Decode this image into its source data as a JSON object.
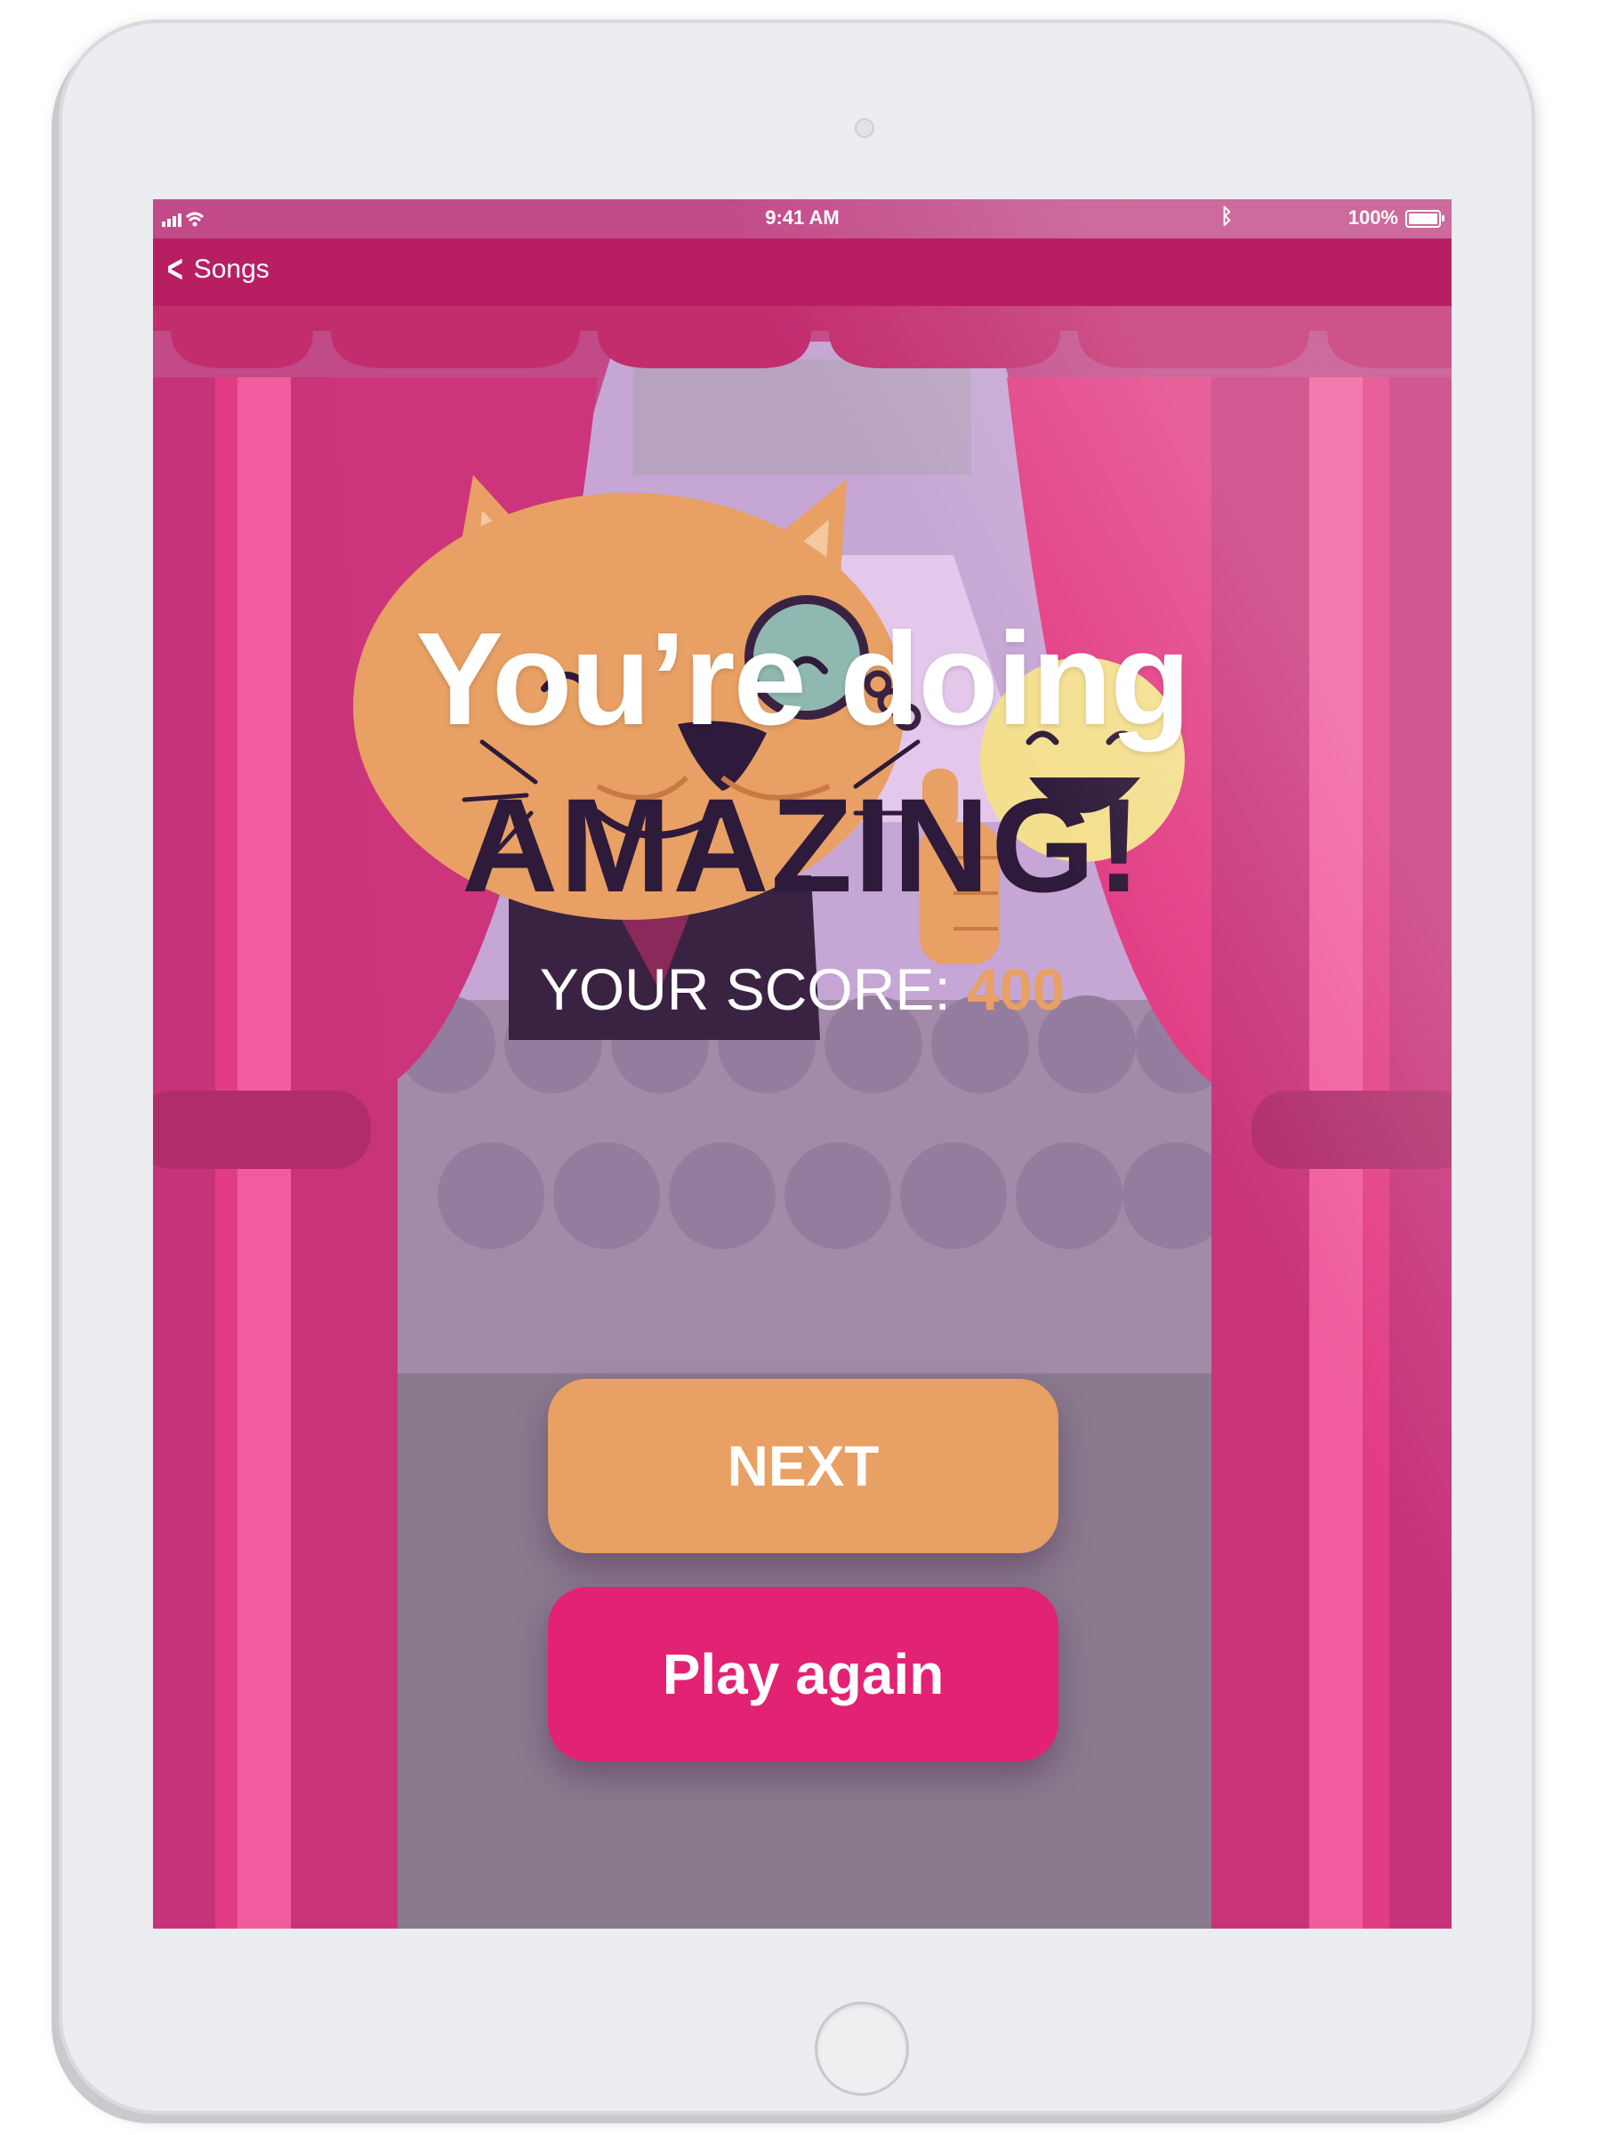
{
  "status_bar": {
    "time": "9:41 AM",
    "battery": "100%"
  },
  "nav": {
    "back_label": "Songs"
  },
  "result": {
    "line1": "You’re doing",
    "line2": "AMAZING!",
    "score_label": "YOUR SCORE:",
    "score_value": "400"
  },
  "actions": {
    "next_label": "NEXT",
    "play_again_label": "Play again"
  },
  "icons": [
    "chevron-left-icon",
    "wifi-icon",
    "signal-icon",
    "bluetooth-icon",
    "battery-icon"
  ],
  "colors": {
    "nav_bar": "#b81f63",
    "curtain": "#e23d84",
    "next_button": "#e8a064",
    "play_again_button": "#e22272",
    "score_value": "#e8a064",
    "headline_dark": "#2e1a3a"
  }
}
